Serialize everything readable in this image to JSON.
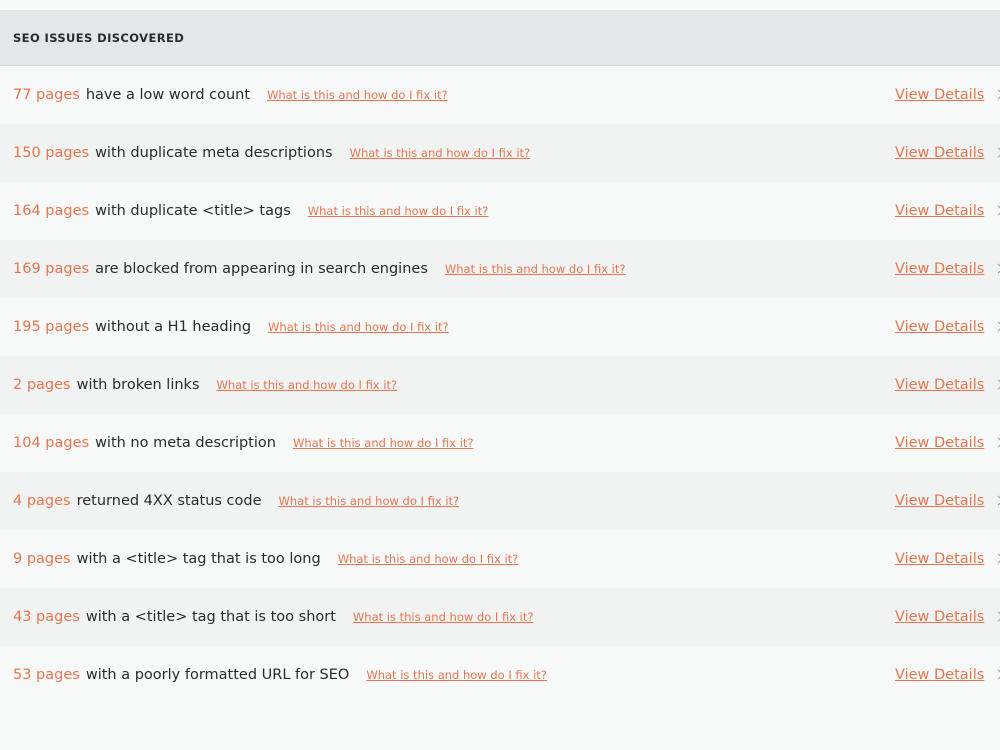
{
  "panel": {
    "title": "SEO ISSUES DISCOVERED"
  },
  "help_link_text": "What is this and how do I fix it?",
  "details_link_text": "View Details",
  "colors": {
    "accent": "#e8744f",
    "text": "#2a2a2a",
    "header_bg": "#e4e6e7"
  },
  "issues": [
    {
      "count": "77 pages",
      "text": "have a low word count",
      "help": "What is this and how do I fix it?",
      "details": "View Details"
    },
    {
      "count": "150 pages",
      "text": "with duplicate meta descriptions",
      "help": "What is this and how do I fix it?",
      "details": "View Details"
    },
    {
      "count": "164 pages",
      "text": "with duplicate <title> tags",
      "help": "What is this and how do I fix it?",
      "details": "View Details"
    },
    {
      "count": "169 pages",
      "text": "are blocked from appearing in search engines",
      "help": "What is this and how do I fix it?",
      "details": "View Details"
    },
    {
      "count": "195 pages",
      "text": "without a H1 heading",
      "help": "What is this and how do I fix it?",
      "details": "View Details"
    },
    {
      "count": "2 pages",
      "text": "with broken links",
      "help": "What is this and how do I fix it?",
      "details": "View Details"
    },
    {
      "count": "104 pages",
      "text": "with no meta description",
      "help": "What is this and how do I fix it?",
      "details": "View Details"
    },
    {
      "count": "4 pages",
      "text": "returned 4XX status code",
      "help": "What is this and how do I fix it?",
      "details": "View Details"
    },
    {
      "count": "9 pages",
      "text": "with a <title> tag that is too long",
      "help": "What is this and how do I fix it?",
      "details": "View Details"
    },
    {
      "count": "43 pages",
      "text": "with a <title> tag that is too short",
      "help": "What is this and how do I fix it?",
      "details": "View Details"
    },
    {
      "count": "53 pages",
      "text": "with a poorly formatted URL for SEO",
      "help": "What is this and how do I fix it?",
      "details": "View Details"
    }
  ]
}
